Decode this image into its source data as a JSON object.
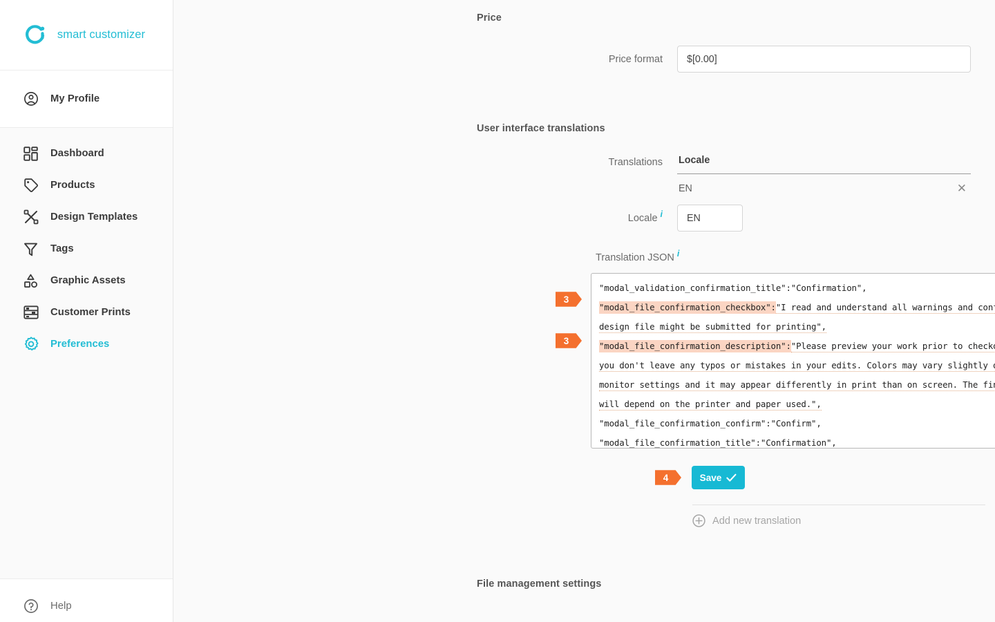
{
  "brand": {
    "name": "smart customizer",
    "logo_icon": "smart-customizer-logo",
    "accent_color": "#23bdd4"
  },
  "sidebar": {
    "profile": {
      "label": "My Profile",
      "icon": "user-circle-icon"
    },
    "items": [
      {
        "label": "Dashboard",
        "icon": "dashboard-grid-icon",
        "active": false
      },
      {
        "label": "Products",
        "icon": "tag-icon",
        "active": false
      },
      {
        "label": "Design Templates",
        "icon": "design-templates-icon",
        "active": false
      },
      {
        "label": "Tags",
        "icon": "funnel-icon",
        "active": false
      },
      {
        "label": "Graphic Assets",
        "icon": "shapes-icon",
        "active": false
      },
      {
        "label": "Customer Prints",
        "icon": "printer-rows-icon",
        "active": false
      },
      {
        "label": "Preferences",
        "icon": "gear-icon",
        "active": true
      }
    ],
    "help": {
      "label": "Help",
      "icon": "question-circle-icon"
    }
  },
  "main": {
    "sections": {
      "price_title": "Price",
      "ui_translations_title": "User interface translations",
      "file_management_title": "File management settings"
    },
    "price": {
      "label": "Price format",
      "value": "$[0.00]",
      "placeholder": "$[0.00]"
    },
    "translations": {
      "label": "Translations",
      "column_header": "Locale",
      "rows": [
        {
          "locale": "EN",
          "remove_icon": "close-icon"
        }
      ]
    },
    "locale_field": {
      "label": "Locale",
      "info_icon": "info-icon",
      "value": "EN",
      "placeholder": "EN"
    },
    "translation_json": {
      "label": "Translation JSON",
      "info_icon": "info-icon",
      "lines": [
        {
          "id": "line-1",
          "segments": [
            {
              "text": "\"modal_validation_confirmation_title\":",
              "style": "plain"
            },
            {
              "text": "\"Confirmation\",",
              "style": "plain"
            }
          ]
        },
        {
          "id": "line-2",
          "segments": [
            {
              "text": "\"modal_file_confirmation_checkbox\":",
              "style": "key-highlight"
            },
            {
              "text": "\"I read and understand all warnings and confirm that this",
              "style": "value-underline"
            }
          ]
        },
        {
          "id": "line-3",
          "segments": [
            {
              "text": "design file might be submitted for printing\",",
              "style": "value-underline"
            }
          ]
        },
        {
          "id": "line-4",
          "segments": [
            {
              "text": "\"modal_file_confirmation_description\":",
              "style": "key-highlight"
            },
            {
              "text": "\"Please preview your work prior to checkout and make sure",
              "style": "value-underline"
            }
          ]
        },
        {
          "id": "line-5",
          "segments": [
            {
              "text": "you don't leave any typos or mistakes in your edits. Colors may vary slightly due to different",
              "style": "value-underline"
            }
          ]
        },
        {
          "id": "line-6",
          "segments": [
            {
              "text": "monitor settings and it may appear differently in print than on screen. The final print quality",
              "style": "value-underline"
            }
          ]
        },
        {
          "id": "line-7",
          "segments": [
            {
              "text": "will depend on the printer and paper used.\",",
              "style": "value-underline"
            }
          ]
        },
        {
          "id": "line-8",
          "segments": [
            {
              "text": "\"modal_file_confirmation_confirm\":\"Confirm\",",
              "style": "plain"
            }
          ]
        },
        {
          "id": "line-9",
          "segments": [
            {
              "text": "\"modal_file_confirmation_title\":\"Confirmation\",",
              "style": "plain"
            }
          ]
        }
      ]
    },
    "save_button": {
      "label": "Save",
      "icon": "check-icon"
    },
    "add_translation": {
      "label": "Add new translation",
      "icon": "plus-circle-icon"
    }
  },
  "step_badges": [
    {
      "id": "badge-3a",
      "number": "3"
    },
    {
      "id": "badge-3b",
      "number": "3"
    },
    {
      "id": "badge-4",
      "number": "4"
    }
  ],
  "chat_widget": {
    "icon": "envelope-icon"
  },
  "colors": {
    "accent_cyan": "#17b9d4",
    "brand_cyan": "#23bdd4",
    "badge_orange": "#f4702e",
    "highlight_peach": "#fbd5c3",
    "underline_orange": "#e0a882",
    "page_bg": "#fafafa",
    "sidebar_bg": "#ffffff"
  }
}
